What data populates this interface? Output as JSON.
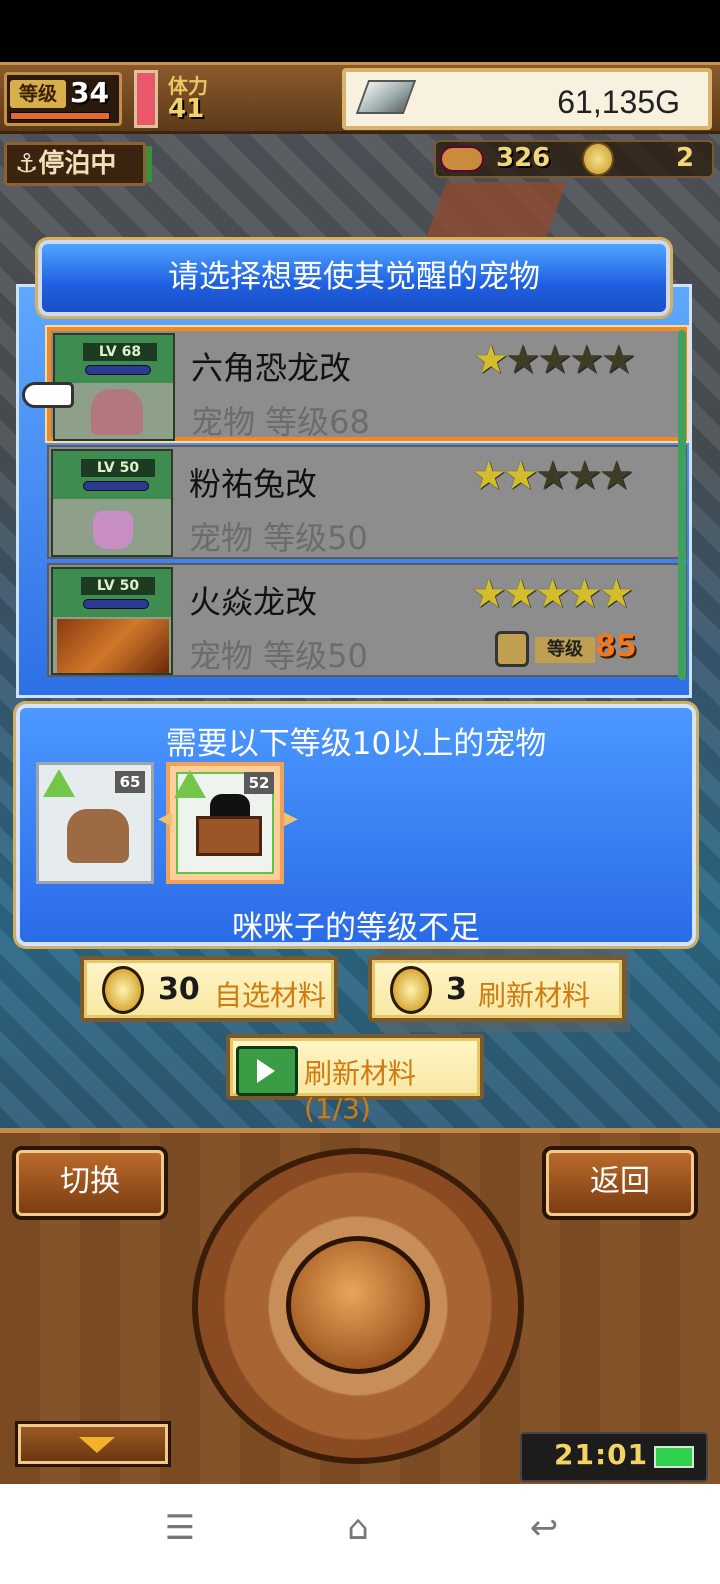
{
  "status": {
    "level_label": "等级",
    "level": "34",
    "stamina_label": "体力",
    "stamina": "41",
    "gold": "61,135G",
    "mode_label": "停泊中",
    "resource_a": "326",
    "resource_b": "2"
  },
  "dialog": {
    "title": "请选择想要使其觉醒的宠物",
    "pets": [
      {
        "lv_tag": "LV 68",
        "name": "六角恐龙改",
        "sub": "宠物 等级68",
        "stars_on": 1,
        "stars_total": 5,
        "selected": true
      },
      {
        "lv_tag": "LV 50",
        "name": "粉祐兔改",
        "sub": "宠物 等级50",
        "stars_on": 2,
        "stars_total": 5
      },
      {
        "lv_tag": "LV 50",
        "name": "火焱龙改",
        "sub": "宠物 等级50",
        "stars_on": 5,
        "stars_total": 5,
        "lock_label": "等级",
        "lock_level": "85"
      }
    ]
  },
  "requirement": {
    "title": "需要以下等级10以上的宠物",
    "materials": [
      {
        "lv": "65"
      },
      {
        "lv": "52",
        "selected": true
      }
    ],
    "warning": "咪咪子的等级不足"
  },
  "actions": {
    "choose_cost": "30",
    "choose_label": "自选材料",
    "refresh_cost": "3",
    "refresh_label": "刷新材料",
    "ad_refresh_label": "刷新材料(1/3)"
  },
  "controls": {
    "switch_label": "切换",
    "back_label": "返回",
    "clock": "21:01"
  },
  "icons": {
    "menu": "menu-icon",
    "home": "home-icon",
    "back": "back-icon"
  }
}
